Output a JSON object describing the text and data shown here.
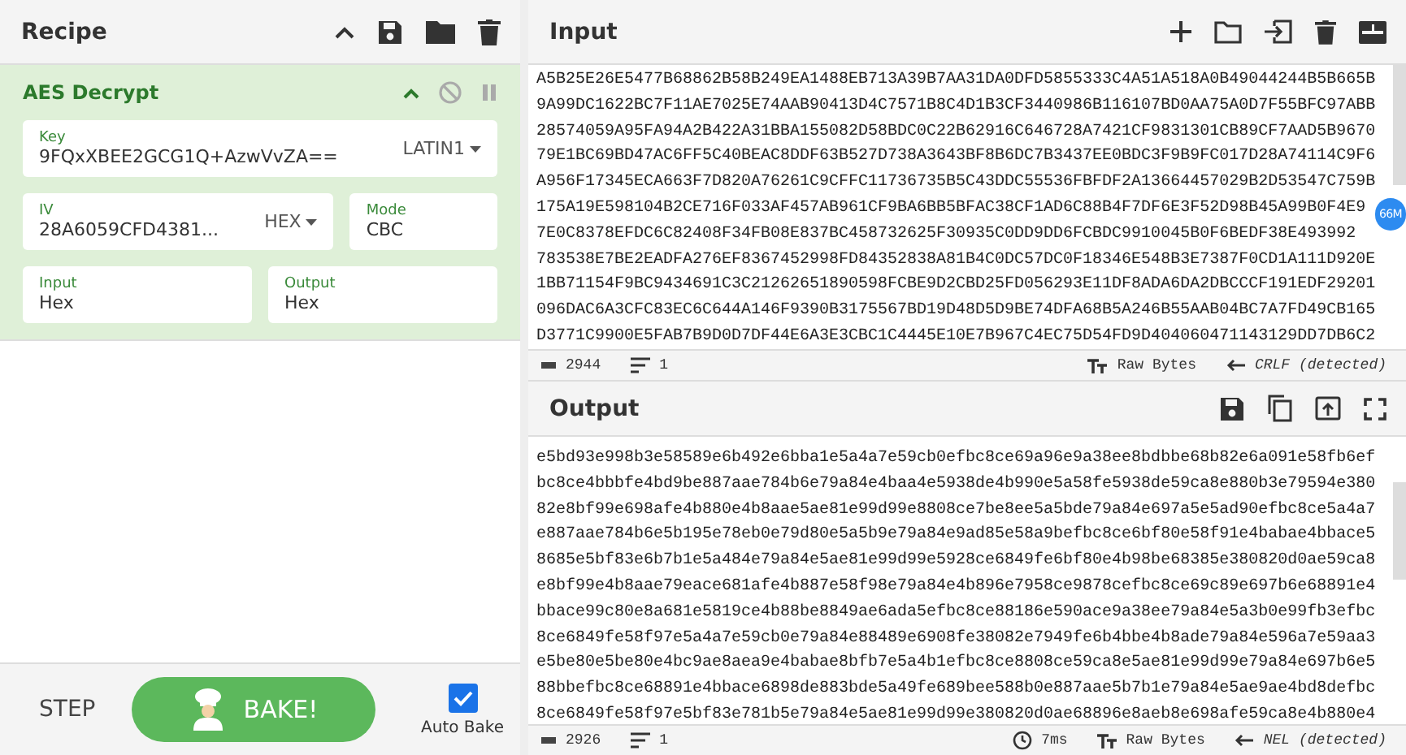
{
  "recipe": {
    "title": "Recipe",
    "operation": {
      "name": "AES Decrypt",
      "disabled": false,
      "paused": false,
      "fields": [
        {
          "kind": "select",
          "label": "Key",
          "value": "9FQxXBEE2GCG1Q+AzwVvZA==",
          "option": "LATIN1"
        },
        {
          "kind": "select",
          "label": "IV",
          "value": "28A6059CFD4381...",
          "option": "HEX"
        },
        {
          "kind": "text",
          "label": "Mode",
          "value": "CBC"
        },
        {
          "kind": "text",
          "label": "Input",
          "value": "Hex"
        },
        {
          "kind": "text",
          "label": "Output",
          "value": "Hex"
        }
      ]
    },
    "step": "STEP",
    "bake": "BAKE!",
    "auto_bake": {
      "label": "Auto Bake",
      "checked": true
    }
  },
  "input": {
    "title": "Input",
    "badge": "66M",
    "lines": [
      "A5B25E26E5477B68862B58B249EA1488EB713A39B7AA31DA0DFD5855333C4A51A518A0B49044244B5B665B",
      "9A99DC1622BC7F11AE7025E74AAB90413D4C7571B8C4D1B3CF3440986B116107BD0AA75A0D7F55BFC97ABB",
      "28574059A95FA94A2B422A31BBA155082D58BDC0C22B62916C646728A7421CF9831301CB89CF7AAD5B9670",
      "79E1BC69BD47AC6FF5C40BEAC8DDF63B527D738A3643BF8B6DC7B3437EE0BDC3F9B9FC017D28A74114C9F6",
      "A956F17345ECA663F7D820A76261C9CFFC11736735B5C43DDC55536FBFDF2A13664457029B2D53547C759B",
      "175A19E598104B2CE716F033AF457AB961CF9BA6BB5BFAC38CF1AD6C88B4F7DF6E3F52D98B45A99B0F4E9",
      "7E0C8378EFDC6C82408F34FB08E837BC458732625F30935C0DD9DD6FCBDC9910045B0F6BEDF38E493992",
      "783538E7BE2EADFA276EF8367452998FD84352838A81B4C0DC57DC0F18346E548B3E7387F0CD1A111D920E",
      "1BB71154F9BC9434691C3C21262651890598FCBE9D2CBD25FD056293E11DF8ADA6DA2DBCCCF191EDF29201",
      "096DAC6A3CFC83EC6C644A146F9390B3175567BD19D48D5D9BE74DFA68B5A246B55AAB04BC7A7FD49CB165",
      "D3771C9900E5FAB7B9D0D7DF44E6A3E3CBC1C4445E10E7B967C4EC75D54FD9D404060471143129DD7DB6C2"
    ],
    "status": {
      "length": "2944",
      "lines": "1",
      "encoding": "Raw Bytes",
      "eol": "CRLF (detected)"
    }
  },
  "output": {
    "title": "Output",
    "lines": [
      "e5bd93e998b3e58589e6b492e6bba1e5a4a7e59cb0efbc8ce69a96e9a38ee8bdbbe68b82e6a091e58fb6ef",
      "bc8ce4bbbfe4bd9be887aae784b6e79a84e4baa4e5938de4b990e5a58fe5938de59ca8e880b3e79594e380",
      "82e8bf99e698afe4b880e4b8aae5ae81e99d99e8808ce7be8ee5a5bde79a84e697a5e5ad90efbc8ce5a4a7",
      "e887aae784b6e5b195e78eb0e79d80e5a5b9e79a84e9ad85e58a9befbc8ce6bf80e58f91e4babae4bbace5",
      "8685e5bf83e6b7b1e5a484e79a84e5ae81e99d99e5928ce6849fe6bf80e4b98be68385e380820d0ae59ca8",
      "e8bf99e4b8aae79eace681afe4b887e58f98e79a84e4b896e7958ce9878cefbc8ce69c89e697b6e68891e4",
      "bbace99c80e8a681e5819ce4b88be8849ae6ada5efbc8ce88186e590ace9a38ee79a84e5a3b0e99fb3efbc",
      "8ce6849fe58f97e5a4a7e59cb0e79a84e88489e6908fe38082e7949fe6b4bbe4b8ade79a84e596a7e59aa3",
      "e5be80e5be80e4bc9ae8aea9e4babae8bfb7e5a4b1efbc8ce8808ce59ca8e5ae81e99d99e79a84e697b6e5",
      "88bbefbc8ce68891e4bbace6898de883bde5a49fe689bee588b0e887aae5b7b1e79a84e5ae9ae4bd8defbc",
      "8ce6849fe58f97e5bf83e781b5e79a84e5ae81e99d99e380820d0ae68896e8aeb8e698afe59ca8e4b880e4"
    ],
    "status": {
      "length": "2926",
      "lines": "1",
      "time": "7ms",
      "encoding": "Raw Bytes",
      "eol": "NEL (detected)"
    }
  }
}
